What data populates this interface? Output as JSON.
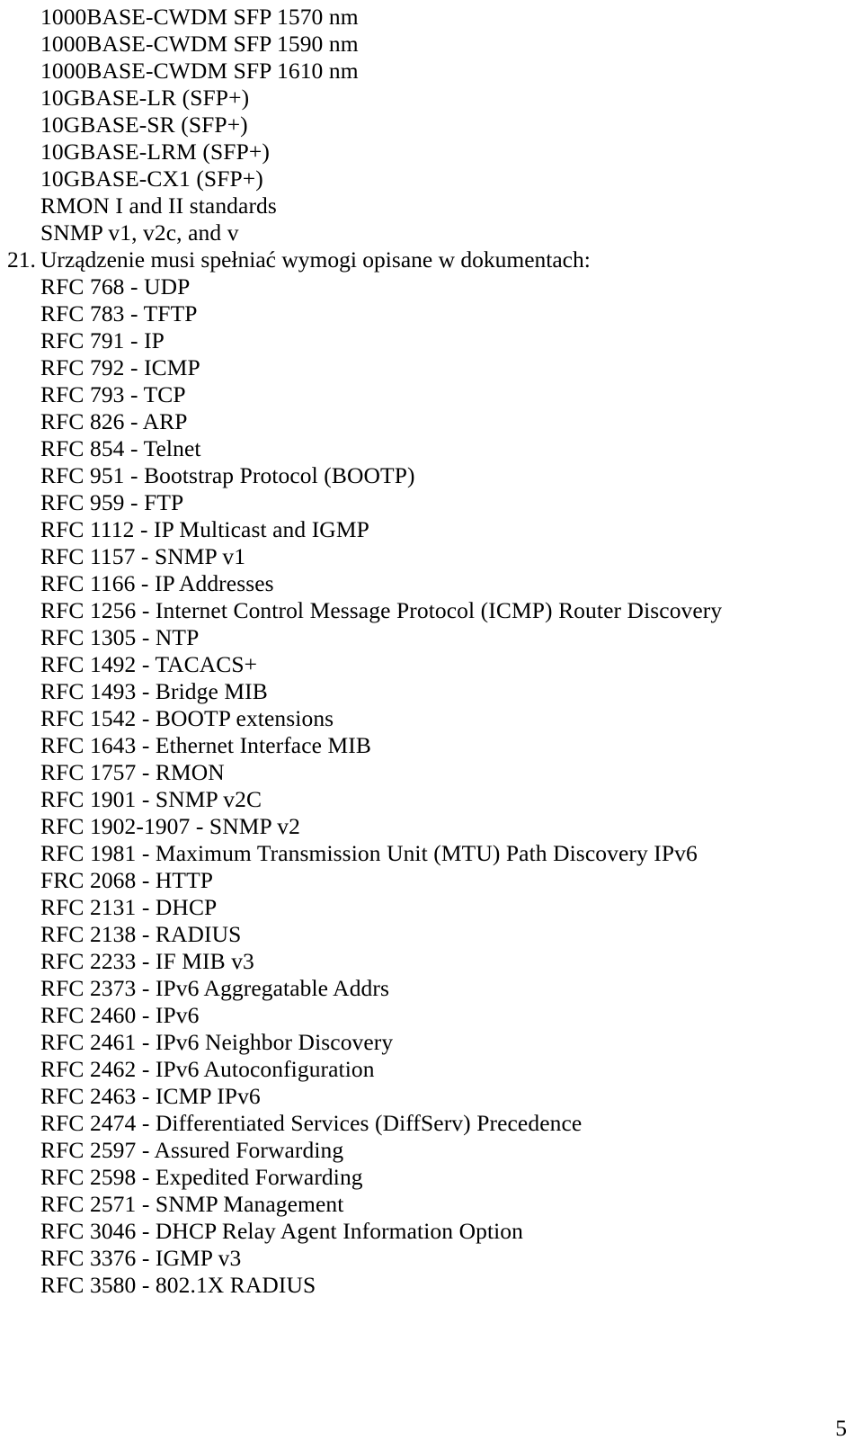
{
  "page": {
    "number": "5",
    "background_color": "#ffffff",
    "text_color": "#000000"
  },
  "continued_list": {
    "lines": [
      "1000BASE-CWDM SFP 1570 nm",
      "1000BASE-CWDM SFP 1590 nm",
      "1000BASE-CWDM SFP 1610 nm",
      "10GBASE-LR (SFP+)",
      "10GBASE-SR (SFP+)",
      "10GBASE-LRM (SFP+)",
      "10GBASE-CX1 (SFP+)",
      "RMON I and II standards",
      "SNMP v1, v2c, and v"
    ]
  },
  "item_21": {
    "marker": "21.",
    "text": "Urządzenie musi spełniać wymogi opisane w dokumentach:",
    "rfcs": [
      "RFC 768 - UDP",
      "RFC 783 - TFTP",
      "RFC 791 - IP",
      "RFC 792 - ICMP",
      "RFC 793 - TCP",
      "RFC 826 - ARP",
      "RFC 854 - Telnet",
      "RFC 951 - Bootstrap Protocol (BOOTP)",
      "RFC 959 - FTP",
      "RFC 1112 - IP Multicast and IGMP",
      "RFC 1157 - SNMP v1",
      "RFC 1166 - IP Addresses",
      "RFC 1256 - Internet Control Message Protocol (ICMP) Router Discovery",
      "RFC 1305 - NTP",
      "RFC 1492 - TACACS+",
      "RFC 1493 - Bridge MIB",
      "RFC 1542 - BOOTP extensions",
      "RFC 1643 - Ethernet Interface MIB",
      "RFC 1757 - RMON",
      "RFC 1901 - SNMP v2C",
      "RFC 1902-1907 - SNMP v2",
      "RFC 1981 - Maximum Transmission Unit (MTU) Path Discovery IPv6",
      "FRC 2068 - HTTP",
      "RFC 2131 - DHCP",
      "RFC 2138 - RADIUS",
      "RFC 2233 - IF MIB v3",
      "RFC 2373 - IPv6 Aggregatable Addrs",
      "RFC 2460 - IPv6",
      "RFC 2461 - IPv6 Neighbor Discovery",
      "RFC 2462 - IPv6 Autoconfiguration",
      "RFC 2463 - ICMP IPv6",
      "RFC 2474 - Differentiated Services (DiffServ) Precedence",
      "RFC 2597 - Assured Forwarding",
      "RFC 2598 - Expedited Forwarding",
      "RFC 2571 - SNMP Management",
      "RFC 3046 - DHCP Relay Agent Information Option",
      "RFC 3376 - IGMP v3",
      "RFC 3580 - 802.1X RADIUS"
    ]
  }
}
